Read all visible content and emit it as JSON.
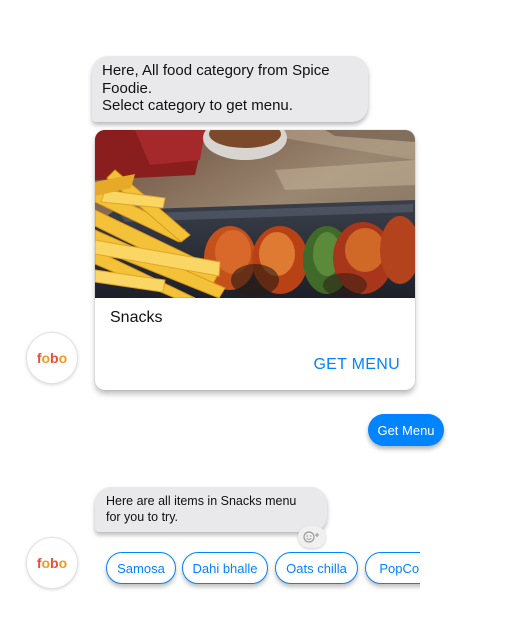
{
  "messages": {
    "intro_line1": "Here, All food category from Spice",
    "intro_line2": "Foodie.",
    "intro_line3": "Select category to get menu.",
    "items_line1": "Here are all items in Snacks menu",
    "items_line2": "for you to try."
  },
  "card": {
    "title": "Snacks",
    "button_label": "GET MENU"
  },
  "user_reply": "Get Menu",
  "bot": {
    "logo_letters": [
      "f",
      "o",
      "b",
      "o"
    ],
    "logo_colors": [
      "#e8503a",
      "#f39a1e",
      "#e8503a",
      "#f39a1e"
    ]
  },
  "reaction_icon": "smiley-add-icon",
  "quick_replies": [
    "Samosa",
    "Dahi bhalle",
    "Oats chilla",
    "PopCorn"
  ],
  "colors": {
    "accent": "#0084ff",
    "bubble_gray": "#e9e9eb"
  }
}
